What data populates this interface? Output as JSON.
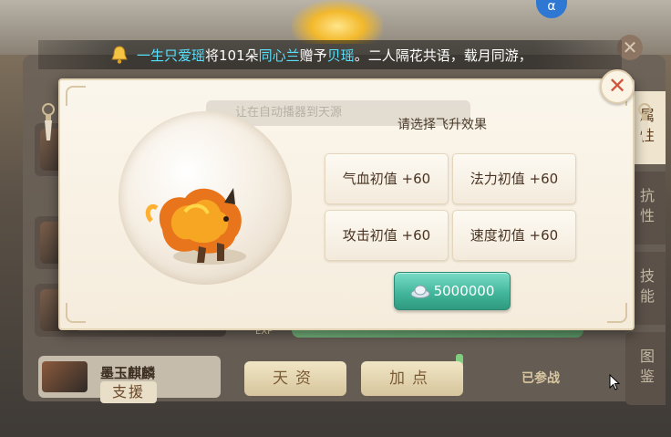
{
  "announcement": {
    "prefix_user": "一生只爱瑶",
    "verb": "将101朵",
    "flower": "同心兰",
    "gift_word": "赠予",
    "target": "贝瑶",
    "suffix": "。二人隔花共语，载月同游，"
  },
  "modal": {
    "prompt": "请选择飞升效果",
    "ghost_text": "让在自动播器到天源",
    "options": [
      {
        "label": "气血初值 +60"
      },
      {
        "label": "法力初值 +60"
      },
      {
        "label": "攻击初值 +60"
      },
      {
        "label": "速度初值 +60"
      }
    ],
    "cost": "5000000",
    "close_symbol": "✕"
  },
  "background": {
    "pet_name": "墨玉麒麟",
    "support_badge": "支援",
    "tab_talent": "天资",
    "tab_points": "加点",
    "joined": "已参战",
    "exp_label": "EXP",
    "side_tabs": [
      "属性",
      "抗性",
      "技能",
      "图鉴"
    ],
    "top_badge": "α",
    "close_symbol": "✕"
  },
  "colors": {
    "highlight_name": "#57e1ff",
    "cost_button": "#43b79b",
    "close_x": "#d0553e"
  }
}
